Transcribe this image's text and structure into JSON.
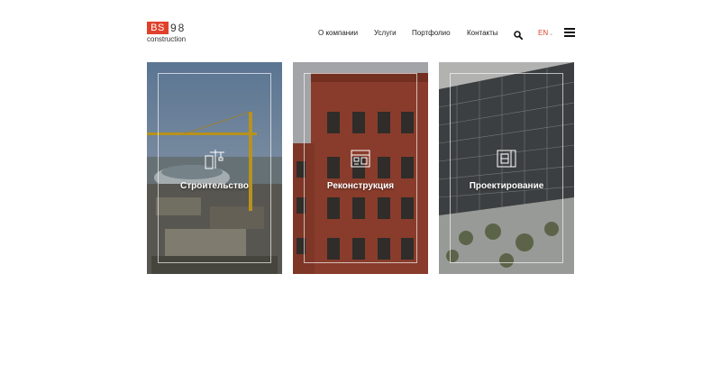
{
  "header": {
    "logo": {
      "badge": "BS",
      "number": "98",
      "subtitle": "construction"
    },
    "nav": [
      {
        "label": "О компании"
      },
      {
        "label": "Услуги"
      },
      {
        "label": "Портфолио"
      },
      {
        "label": "Контакты"
      }
    ],
    "search_icon": "search-icon",
    "language": "EN",
    "menu_icon": "hamburger-icon"
  },
  "cards": [
    {
      "title": "Строительство",
      "icon": "crane-icon"
    },
    {
      "title": "Реконструкция",
      "icon": "building-plan-icon"
    },
    {
      "title": "Проектирование",
      "icon": "blueprint-icon"
    }
  ],
  "colors": {
    "accent": "#e0412c",
    "text": "#222222",
    "background": "#ffffff"
  }
}
